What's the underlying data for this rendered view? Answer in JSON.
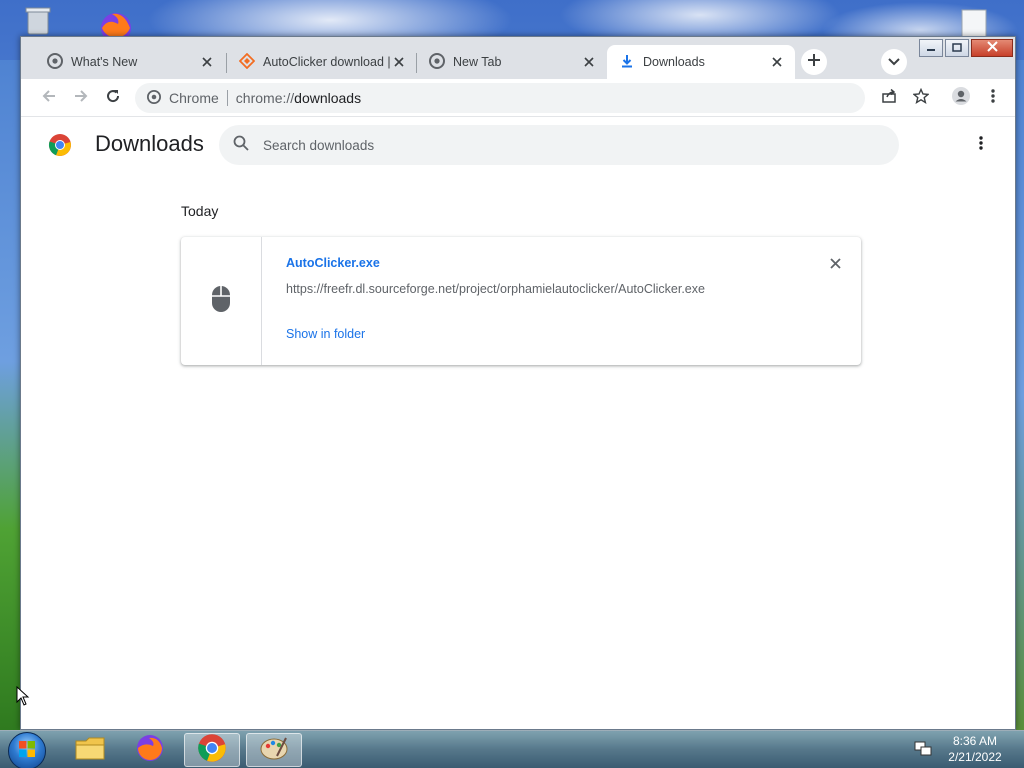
{
  "tabs": [
    {
      "title": "What's New",
      "icon": "chrome-icon",
      "active": false
    },
    {
      "title": "AutoClicker download |",
      "icon": "sourceforge-icon",
      "active": false
    },
    {
      "title": "New Tab",
      "icon": "chrome-icon",
      "active": false
    },
    {
      "title": "Downloads",
      "icon": "download-icon",
      "active": true
    }
  ],
  "toolbar": {
    "omnibox_chip": "Chrome",
    "url_scheme": "chrome://",
    "url_host": "downloads"
  },
  "downloads": {
    "title": "Downloads",
    "search_placeholder": "Search downloads",
    "date_heading": "Today",
    "items": [
      {
        "file_name": "AutoClicker.exe",
        "url": "https://freefr.dl.sourceforge.net/project/orphamielautoclicker/AutoClicker.exe",
        "action": "Show in folder",
        "file_icon": "mouse-icon"
      }
    ]
  },
  "taskbar": {
    "time": "8:36 AM",
    "date": "2/21/2022"
  },
  "colors": {
    "accent": "#1a73e8",
    "tabstrip": "#dee1e6",
    "omnibox": "#f1f3f4"
  }
}
